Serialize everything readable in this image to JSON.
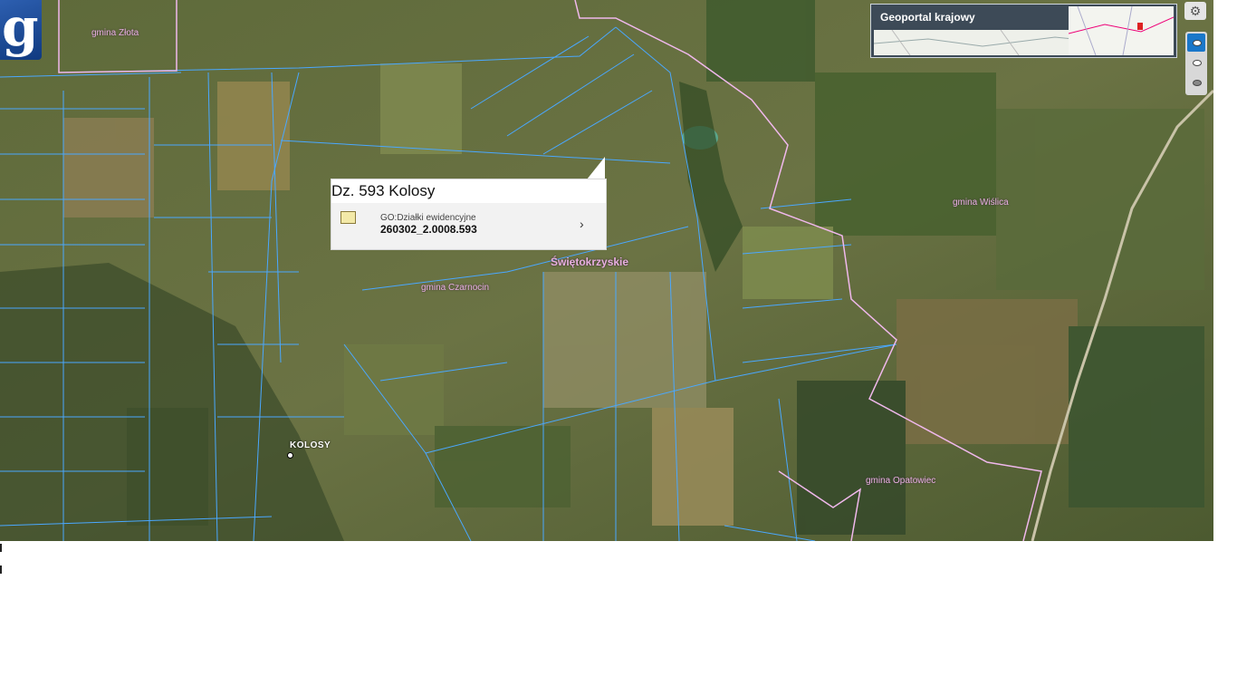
{
  "app": {
    "logo_letter": "g",
    "overview_title": "Geoportal krajowy",
    "settings_icon": "gear-icon",
    "layer_buttons": [
      "eye-icon-active",
      "eye-icon",
      "eye-icon"
    ]
  },
  "popup": {
    "title": "Dz. 593 Kolosy",
    "layer_name": "GO:Działki ewidencyjne",
    "parcel_id": "260302_2.0008.593",
    "icon": "parcel-map-icon",
    "arrow": "›"
  },
  "map_labels": {
    "gmina_zlota": "gmina Złota",
    "gmina_wislica": "gmina Wiślica",
    "gmina_czarnocin": "gmina Czarnocin",
    "gmina_opatowiec": "gmina Opatowiec",
    "region": "Świętokrzyskie",
    "village": "KOLOSY"
  },
  "colors": {
    "parcel_lines": "#4aa8ff",
    "admin_border": "#f0b8ec",
    "accent": "#1a77c9"
  }
}
